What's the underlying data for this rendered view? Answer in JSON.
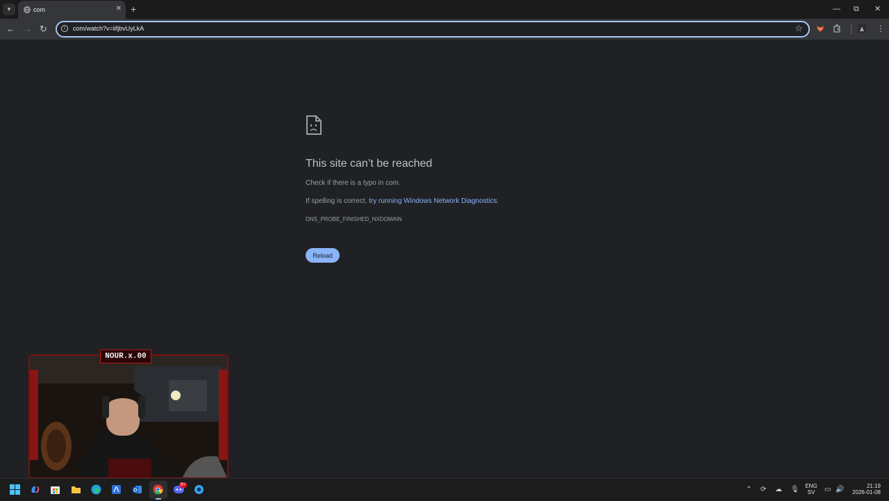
{
  "browser": {
    "tab": {
      "title": "com"
    },
    "address_bar": {
      "url": "com/watch?v=iifjbvUyLkA"
    }
  },
  "error_page": {
    "title": "This site can’t be reached",
    "line1": "Check if there is a typo in com.",
    "line2_prefix": "If spelling is correct, ",
    "line2_link": "try running Windows Network Diagnostics",
    "line2_suffix": ".",
    "error_code": "DNS_PROBE_FINISHED_NXDOMAIN",
    "reload_label": "Reload"
  },
  "webcam": {
    "name": "NOUR.x.00"
  },
  "taskbar": {
    "lang_primary": "ENG",
    "lang_secondary": "SV",
    "time": "21:19",
    "date": "2026-01-08",
    "discord_badge": "9+"
  },
  "icons": {
    "tab_search": "chevron-down-icon",
    "favicon": "globe-icon",
    "new_tab": "plus-icon",
    "back": "arrow-left-icon",
    "forward": "arrow-right-icon",
    "reload": "reload-icon",
    "site_info": "info-icon",
    "bookmark": "star-icon",
    "extensions": "puzzle-icon",
    "menu": "three-dots-icon",
    "error": "sad-document-icon"
  },
  "colors": {
    "page_bg": "#202124",
    "toolbar_bg": "#35363a",
    "accent": "#8ab4f8",
    "omnibox_border": "#a8c7fa",
    "webcam_frame": "#7b1010"
  }
}
